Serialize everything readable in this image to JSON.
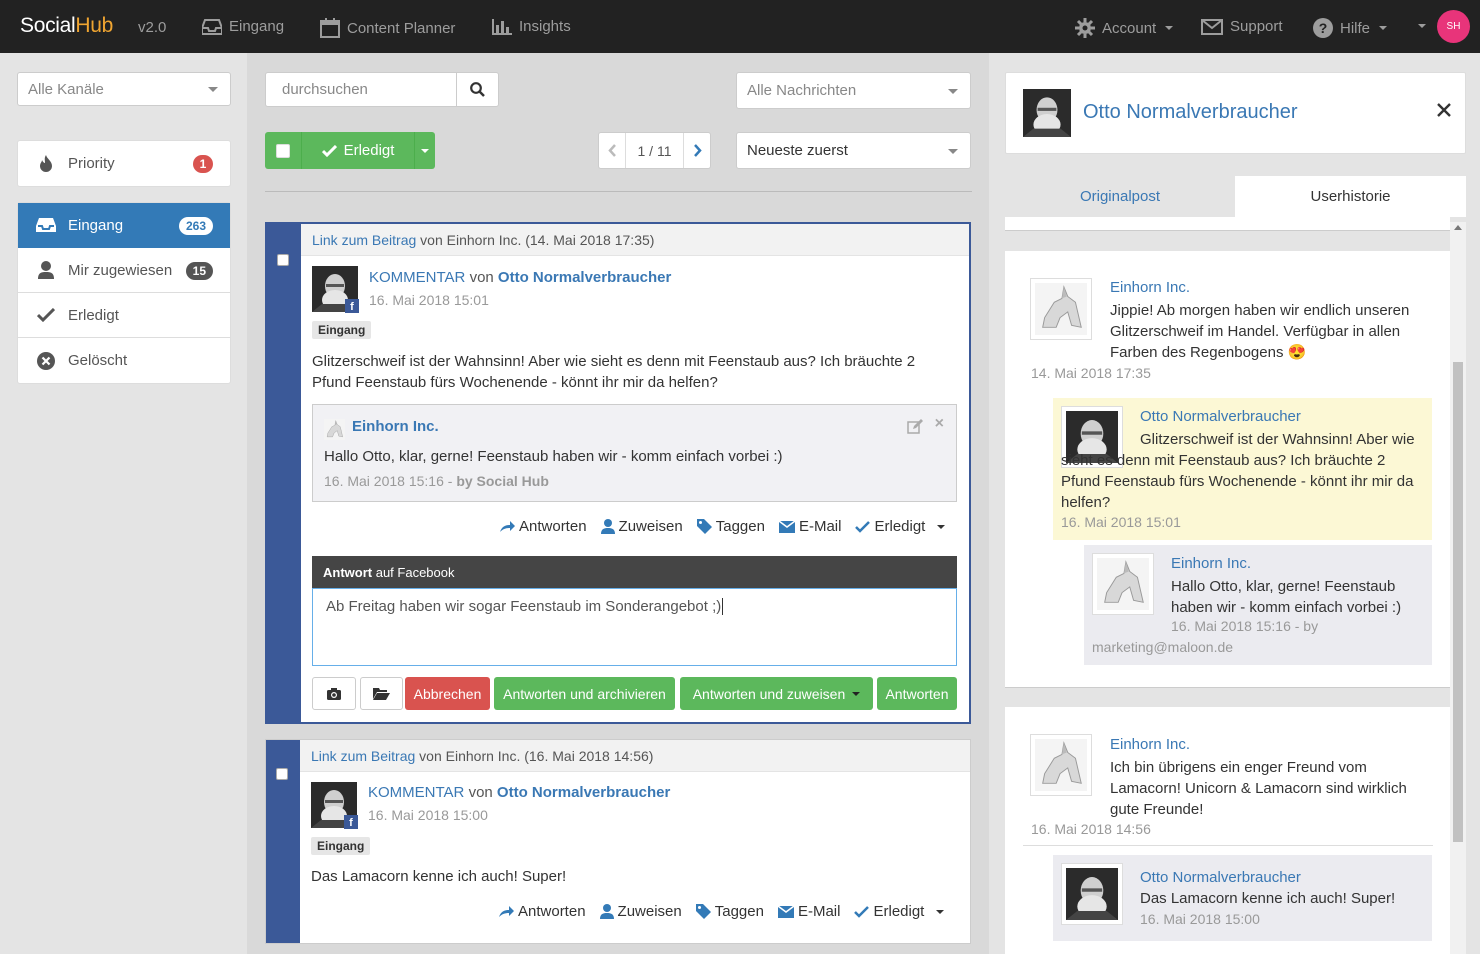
{
  "topbar": {
    "logo_a": "Social",
    "logo_b": "Hub",
    "version": "v2.0",
    "nav": [
      {
        "label": "Eingang",
        "icon": "inbox-icon"
      },
      {
        "label": "Content Planner",
        "icon": "calendar-icon"
      },
      {
        "label": "Insights",
        "icon": "bar-chart-icon"
      }
    ],
    "account": "Account",
    "support": "Support",
    "help": "Hilfe",
    "avatar": "SH"
  },
  "sidebar": {
    "channel_select": "Alle Kanäle",
    "priority": {
      "label": "Priority",
      "count": "1"
    },
    "items": [
      {
        "label": "Eingang",
        "count": "263"
      },
      {
        "label": "Mir zugewiesen",
        "count": "15"
      },
      {
        "label": "Erledigt"
      },
      {
        "label": "Gelöscht"
      }
    ]
  },
  "toolbar": {
    "search_placeholder": "durchsuchen",
    "message_filter": "Alle Nachrichten",
    "sort": "Neueste zuerst",
    "done_label": "Erledigt",
    "pagination": "1 / 11"
  },
  "cards": [
    {
      "link": "Link zum Beitrag",
      "source": "von Einhorn Inc. (14. Mai 2018 17:35)",
      "type": "KOMMENTAR",
      "von": "von",
      "author": "Otto Normalverbraucher",
      "time": "16. Mai 2018 15:01",
      "tag": "Eingang",
      "text": "Glitzerschweif ist der Wahnsinn! Aber wie sieht es denn mit Feenstaub aus? Ich bräuchte 2 Pfund Feenstaub fürs Wochenende - könnt ihr mir da helfen?",
      "reply": {
        "author": "Einhorn Inc.",
        "text": "Hallo Otto, klar, gerne! Feenstaub haben wir - komm einfach vorbei :)",
        "time": "16. Mai 2018 15:16 - ",
        "by": "by Social Hub"
      },
      "composer": {
        "title_bold": "Antwort",
        "title_rest": " auf Facebook",
        "value": "Ab Freitag haben wir sogar Feenstaub im Sonderangebot ;)",
        "cancel": "Abbrechen",
        "archive": "Antworten und archivieren",
        "assign": "Antworten und zuweisen",
        "reply": "Antworten"
      }
    },
    {
      "link": "Link zum Beitrag",
      "source": "von Einhorn Inc. (16. Mai 2018 14:56)",
      "type": "KOMMENTAR",
      "von": "von",
      "author": "Otto Normalverbraucher",
      "time": "16. Mai 2018 15:00",
      "tag": "Eingang",
      "text": "Das Lamacorn kenne ich auch! Super!"
    }
  ],
  "actions": {
    "reply": "Antworten",
    "assign": "Zuweisen",
    "tag": "Taggen",
    "email": "E-Mail",
    "done": "Erledigt"
  },
  "profile": {
    "name": "Otto Normalverbraucher",
    "tabs": [
      "Originalpost",
      "Userhistorie"
    ],
    "history": [
      {
        "post": {
          "author": "Einhorn Inc.",
          "text": "Jippie! Ab morgen haben wir endlich unseren Glitzerschweif im Handel. Verfügbar in allen Farben des Regenbogens",
          "emoji": "😍",
          "time": "14. Mai 2018 17:35"
        },
        "comment": {
          "author": "Otto Normalverbraucher",
          "text": "Glitzerschweif ist der Wahnsinn! Aber wie sieht es denn mit Feenstaub aus? Ich bräuchte 2 Pfund Feenstaub fürs Wochenende - könnt ihr mir da helfen?",
          "time": "16. Mai 2018 15:01"
        },
        "reply": {
          "author": "Einhorn Inc.",
          "text": "Hallo Otto, klar, gerne! Feenstaub haben wir - komm einfach vorbei :)",
          "time": "16. Mai 2018 15:16 - by",
          "by": "marketing@maloon.de"
        }
      },
      {
        "post": {
          "author": "Einhorn Inc.",
          "text": "Ich bin übrigens ein enger Freund vom Lamacorn! Unicorn & Lamacorn sind wirklich gute Freunde!",
          "time": "16. Mai 2018 14:56"
        },
        "comment": {
          "author": "Otto Normalverbraucher",
          "text": "Das Lamacorn kenne ich auch! Super!",
          "time": "16. Mai 2018 15:00"
        }
      }
    ]
  },
  "colors": {
    "topbar": "#222222",
    "primary": "#337ab7",
    "success": "#5cb85c",
    "danger": "#d9534f",
    "facebook": "#3b5998",
    "highlight": "#fcf8d5"
  }
}
